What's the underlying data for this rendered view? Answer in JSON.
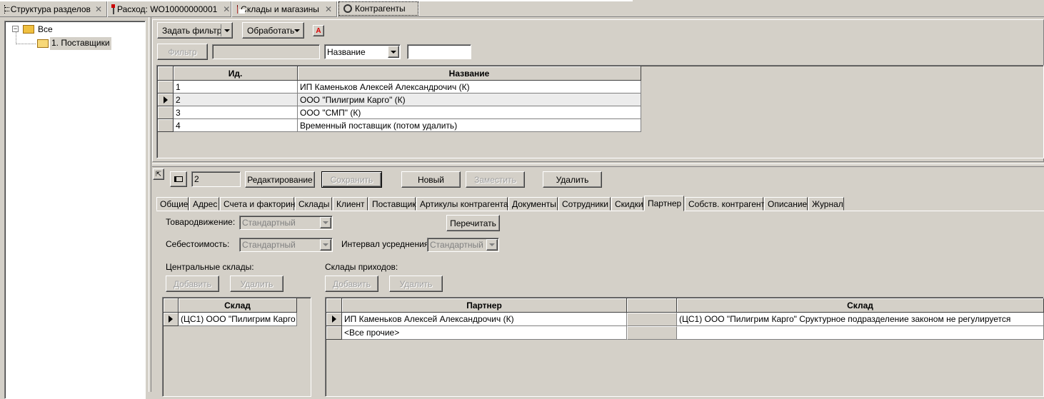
{
  "tabs": [
    {
      "label": "Структура разделов",
      "icon": "tree-icon"
    },
    {
      "label": "Расход: WO10000000001",
      "icon": "document-icon"
    },
    {
      "label": "Склады и магазины",
      "icon": "warehouse-icon"
    },
    {
      "label": "Контрагенты",
      "icon": "gear-icon"
    }
  ],
  "tree": {
    "root": "Все",
    "child": "1. Поставщики"
  },
  "toolbar": {
    "filter_button": "Задать фильтр",
    "process_button": "Обработать",
    "a_button": "A",
    "filter_apply": "Фильтр",
    "field_select": "Название",
    "filter_value": ""
  },
  "grid": {
    "headers": [
      "Ид.",
      "Название"
    ],
    "rows": [
      {
        "id": "1",
        "name": "ИП Каменьков Алексей Александрочич (К)"
      },
      {
        "id": "2",
        "name": "ООО \"Пилигрим Карго\" (К)"
      },
      {
        "id": "3",
        "name": "ООО \"СМП\" (К)"
      },
      {
        "id": "4",
        "name": "Временный поставщик (потом удалить)"
      }
    ]
  },
  "record": {
    "current_id": "2",
    "edit_button": "Редактирование",
    "save_button": "Сохранить",
    "new_button": "Новый",
    "replace_button": "Заместить",
    "delete_button": "Удалить"
  },
  "detail_tabs": [
    "Общие",
    "Адрес",
    "Счета и факторинг",
    "Склады",
    "Клиент",
    "Поставщик",
    "Артикулы контрагента",
    "Документы",
    "Сотрудники",
    "Скидки",
    "Партнер",
    "Собств. контрагент",
    "Описание",
    "Журнал"
  ],
  "partner": {
    "movement_label": "Товародвижение:",
    "movement_value": "Стандартный",
    "reread_button": "Перечитать",
    "cost_label": "Себестоимость:",
    "cost_value": "Стандартный",
    "interval_label": "Интервал усреднения:",
    "interval_value": "Стандартный",
    "central_label": "Центральные склады:",
    "receipt_label": "Склады приходов:",
    "add_button": "Добавить",
    "remove_button": "Удалить",
    "add_button2": "Добавить",
    "remove_button2": "Удалить",
    "central_header": "Склад",
    "central_rows": [
      "(ЦС1) ООО \"Пилигрим Карго"
    ],
    "receipt_headers": [
      "Партнер",
      "Склад"
    ],
    "receipt_rows": [
      {
        "partner": "ИП Каменьков Алексей Александрочич (К)",
        "warehouse": "(ЦС1) ООО \"Пилигрим Карго\" Сруктурное подразделение законом не регулируется"
      },
      {
        "partner": "<Все прочие>",
        "warehouse": ""
      }
    ]
  }
}
